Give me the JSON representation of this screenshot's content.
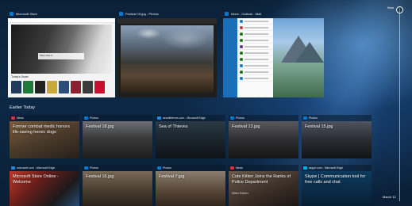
{
  "windows": [
    {
      "title": "Microsoft Store",
      "icon": "store-icon",
      "accent": "#0078d4"
    },
    {
      "title": "Festival 19.jpg - Photos",
      "icon": "photos-icon",
      "accent": "#0078d4"
    },
    {
      "title": "Inbox - Outlook - Mail",
      "icon": "mail-icon",
      "accent": "#0078d4"
    }
  ],
  "section_title": "Earlier Today",
  "cards_row1": [
    {
      "app": "News",
      "icon": "news-icon",
      "accent": "#d13438",
      "title": "Former combat medic honors life-saving heroic dogs",
      "subtitle": ""
    },
    {
      "app": "Photos",
      "icon": "photos-icon",
      "accent": "#0078d4",
      "title": "Festival 18.jpg",
      "subtitle": ""
    },
    {
      "app": "seaofthieves.com - Microsoft Edge",
      "icon": "edge-icon",
      "accent": "#1d8ae6",
      "title": "Sea of Thieves",
      "subtitle": ""
    },
    {
      "app": "Photos",
      "icon": "photos-icon",
      "accent": "#0078d4",
      "title": "Festival 13.jpg",
      "subtitle": ""
    },
    {
      "app": "Photos",
      "icon": "photos-icon",
      "accent": "#0078d4",
      "title": "Festival 15.jpg",
      "subtitle": ""
    }
  ],
  "cards_row2": [
    {
      "app": "microsoft.com - Microsoft Edge",
      "icon": "edge-icon",
      "accent": "#1d8ae6",
      "title": "Microsoft Store Online - Welcome",
      "subtitle": ""
    },
    {
      "app": "Photos",
      "icon": "photos-icon",
      "accent": "#0078d4",
      "title": "Festival 16.jpg",
      "subtitle": ""
    },
    {
      "app": "Photos",
      "icon": "photos-icon",
      "accent": "#0078d4",
      "title": "Festival 7.jpg",
      "subtitle": ""
    },
    {
      "app": "News",
      "icon": "news-icon",
      "accent": "#d13438",
      "title": "Cute Kitten Joins the Ranks of Police Department",
      "subtitle": "Kitten Edition"
    },
    {
      "app": "skype.com - Microsoft Edge",
      "icon": "skype-icon",
      "accent": "#00aff0",
      "title": "Skype | Communication tool for free calls and chat",
      "subtitle": ""
    }
  ],
  "timeline": {
    "top_label": "Now",
    "bottom_label": "March 12"
  },
  "store": {
    "section_label": "Today's Deals",
    "promo_text": "Xbox One X"
  }
}
